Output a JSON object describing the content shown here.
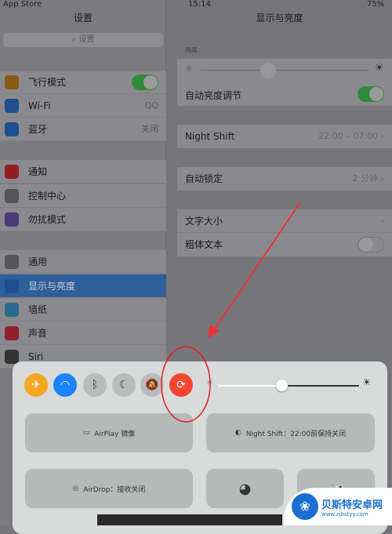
{
  "status": {
    "left": "App Store",
    "time": "15:14",
    "battery": "75%"
  },
  "sidebar": {
    "title": "设置",
    "search_placeholder": "设置",
    "items": [
      {
        "label": "飞行模式",
        "icon": "airplane-icon",
        "color": "#8a5a14",
        "toggle": true
      },
      {
        "label": "Wi-Fi",
        "icon": "wifi-icon",
        "color": "#1d4f8f",
        "value": "QQ"
      },
      {
        "label": "蓝牙",
        "icon": "bluetooth-icon",
        "color": "#1d4f8f",
        "value": "关闭"
      },
      {
        "label": "通知",
        "icon": "notification-icon",
        "color": "#8f2020"
      },
      {
        "label": "控制中心",
        "icon": "control-center-icon",
        "color": "#555"
      },
      {
        "label": "勿扰模式",
        "icon": "moon-icon",
        "color": "#4a3a7a"
      },
      {
        "label": "通用",
        "icon": "gear-icon",
        "color": "#555"
      },
      {
        "label": "显示与亮度",
        "icon": "display-icon",
        "color": "#1d4f8f",
        "selected": true
      },
      {
        "label": "墙纸",
        "icon": "wallpaper-icon",
        "color": "#2a6a8a"
      },
      {
        "label": "声音",
        "icon": "sound-icon",
        "color": "#8f2030"
      },
      {
        "label": "Siri",
        "icon": "siri-icon",
        "color": "#333"
      }
    ]
  },
  "main": {
    "title": "显示与亮度",
    "brightness_label": "亮度",
    "brightness": 0.4,
    "auto_brightness": "自动亮度调节",
    "night_shift": {
      "label": "Night Shift",
      "value": "22:00 – 07:00"
    },
    "auto_lock": {
      "label": "自动锁定",
      "value": "2 分钟"
    },
    "text_size": "文字大小",
    "bold_text": "粗体文本"
  },
  "control_center": {
    "brightness": 0.45,
    "airplay": "AirPlay 镜像",
    "night_shift": "Night Shift：22:00前保持关闭",
    "airdrop": "AirDrop：接收关闭",
    "colors": {
      "airplane": "#f5a623",
      "wifi": "#1a82fb",
      "rotation_lock": "#f4452f"
    }
  },
  "watermark": {
    "name": "贝斯特安卓网",
    "url": "www.zjbstyy.com"
  }
}
